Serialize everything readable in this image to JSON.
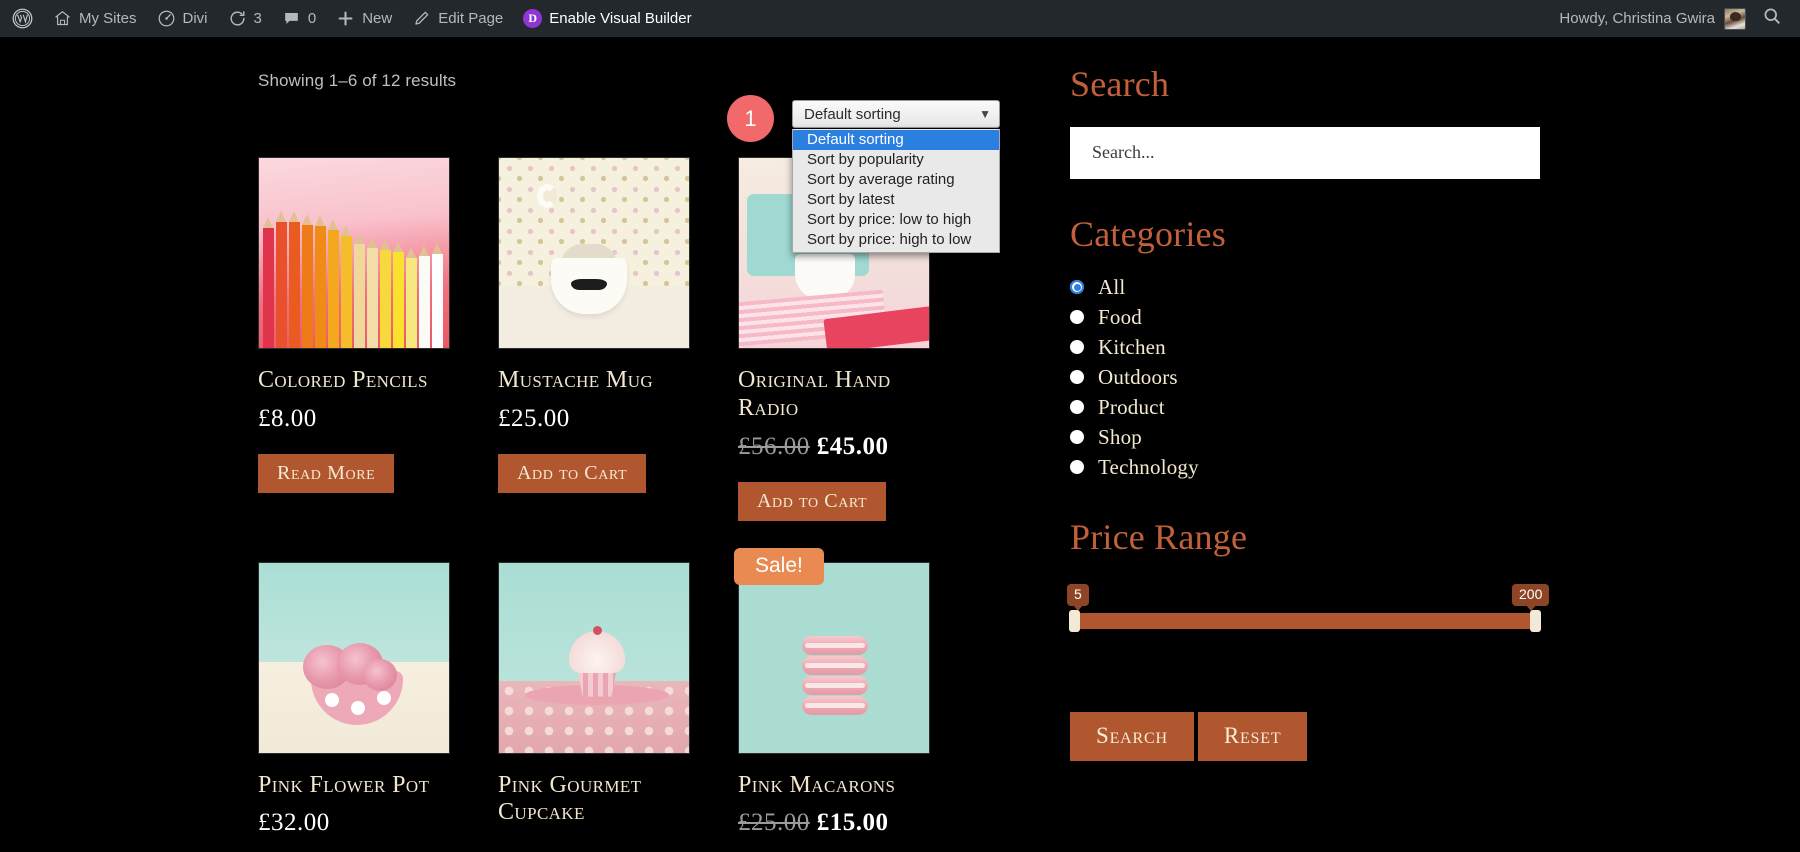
{
  "admin_bar": {
    "left_items": [
      {
        "id": "wp-logo",
        "label": "",
        "icon": "wordpress-icon"
      },
      {
        "id": "my-sites",
        "label": "My Sites",
        "icon": "sites-icon"
      },
      {
        "id": "divi",
        "label": "Divi",
        "icon": "divi-dashboard-icon"
      },
      {
        "id": "updates",
        "label": "3",
        "icon": "updates-icon"
      },
      {
        "id": "comments",
        "label": "0",
        "icon": "comment-bubble-icon"
      },
      {
        "id": "new",
        "label": "New",
        "icon": "plus-icon"
      },
      {
        "id": "edit-page",
        "label": "Edit Page",
        "icon": "pencil-icon"
      },
      {
        "id": "visual-builder",
        "label": "Enable Visual Builder",
        "icon": "divi-d-icon"
      }
    ],
    "howdy": "Howdy, Christina Gwira",
    "search_icon": "search-icon"
  },
  "shop": {
    "result_count": "Showing 1–6 of 12 results",
    "step_badge": "1",
    "ordering": {
      "selected": "Default sorting",
      "expanded": true,
      "options": [
        "Default sorting",
        "Sort by popularity",
        "Sort by average rating",
        "Sort by latest",
        "Sort by price: low to high",
        "Sort by price: high to low"
      ]
    },
    "products": [
      {
        "title": "Colored Pencils",
        "price": "£8.00",
        "old_price": "",
        "button": "Read More",
        "on_sale": false,
        "image": "colored-pencils-photo"
      },
      {
        "title": "Mustache Mug",
        "price": "£25.00",
        "old_price": "",
        "button": "Add to Cart",
        "on_sale": false,
        "image": "mustache-mug-photo"
      },
      {
        "title": "Original Hand Radio",
        "price": "£45.00",
        "old_price": "£56.00",
        "button": "Add to Cart",
        "on_sale": false,
        "image": "hand-radio-desk-photo"
      },
      {
        "title": "Pink Flower Pot",
        "price": "£32.00",
        "old_price": "",
        "button": "",
        "on_sale": false,
        "image": "pink-flower-pot-photo"
      },
      {
        "title": "Pink Gourmet Cupcake",
        "price": "",
        "old_price": "",
        "button": "",
        "on_sale": false,
        "image": "pink-cupcake-photo"
      },
      {
        "title": "Pink Macarons",
        "price": "£15.00",
        "old_price": "£25.00",
        "button": "",
        "on_sale": true,
        "sale_label": "Sale!",
        "image": "pink-macarons-photo"
      }
    ]
  },
  "sidebar": {
    "search": {
      "title": "Search",
      "placeholder": "Search..."
    },
    "categories": {
      "title": "Categories",
      "items": [
        {
          "label": "All",
          "selected": true
        },
        {
          "label": "Food",
          "selected": false
        },
        {
          "label": "Kitchen",
          "selected": false
        },
        {
          "label": "Outdoors",
          "selected": false
        },
        {
          "label": "Product",
          "selected": false
        },
        {
          "label": "Shop",
          "selected": false
        },
        {
          "label": "Technology",
          "selected": false
        }
      ]
    },
    "price_range": {
      "title": "Price Range",
      "min": "5",
      "max": "200"
    },
    "buttons": {
      "search": "Search",
      "reset": "Reset"
    }
  },
  "colors": {
    "admin_bar_bg": "#23282d",
    "page_bg": "#000000",
    "accent_heading": "#c1603a",
    "button_bg": "#b1572f",
    "sale_badge_bg": "#e98a53",
    "step_badge_bg": "#f2696c",
    "product_title": "#f3e6cf",
    "select_highlight": "#2a7fe0"
  }
}
